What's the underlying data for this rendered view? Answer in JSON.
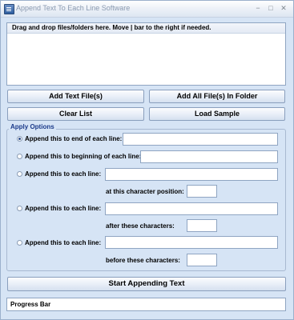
{
  "window": {
    "title": "Append Text To Each Line Software",
    "minimize_glyph": "−",
    "maximize_glyph": "□",
    "close_glyph": "✕"
  },
  "dropzone": {
    "header": "Drag and drop files/folders here. Move | bar to the right if needed."
  },
  "buttons": {
    "add_text_files": "Add Text File(s)",
    "add_all_files": "Add All File(s) In Folder",
    "clear_list": "Clear List",
    "load_sample": "Load Sample",
    "start": "Start Appending Text"
  },
  "options": {
    "legend": "Apply Options",
    "end_of_line": {
      "label": "Append this to end of each line:",
      "value": "",
      "selected": true
    },
    "beginning_of_line": {
      "label": "Append this to beginning of each line:",
      "value": "",
      "selected": false
    },
    "at_position": {
      "label": "Append this to each line:",
      "value": "",
      "sub_label": "at this character position:",
      "sub_value": "",
      "selected": false
    },
    "after_chars": {
      "label": "Append this to each line:",
      "value": "",
      "sub_label": "after these characters:",
      "sub_value": "",
      "selected": false
    },
    "before_chars": {
      "label": "Append this to each line:",
      "value": "",
      "sub_label": "before these characters:",
      "sub_value": "",
      "selected": false
    }
  },
  "progress": {
    "label": "Progress Bar"
  },
  "colors": {
    "window_bg": "#d6e4f5",
    "legend_text": "#1b3a8a"
  }
}
